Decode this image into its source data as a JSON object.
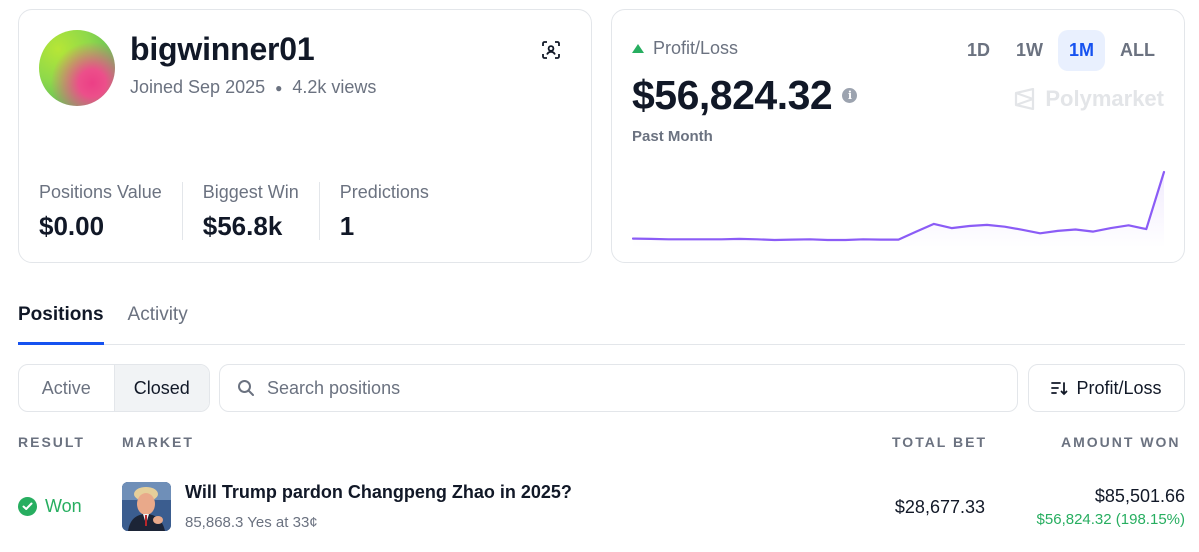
{
  "profile": {
    "username": "bigwinner01",
    "joined": "Joined Sep 2025",
    "views": "4.2k views",
    "stats": [
      {
        "label": "Positions Value",
        "value": "$0.00"
      },
      {
        "label": "Biggest Win",
        "value": "$56.8k"
      },
      {
        "label": "Predictions",
        "value": "1"
      }
    ]
  },
  "pnl": {
    "label": "Profit/Loss",
    "value": "$56,824.32",
    "period": "Past Month",
    "brand": "Polymarket",
    "ranges": [
      "1D",
      "1W",
      "1M",
      "ALL"
    ],
    "active_range": "1M",
    "accent": "#8b5cf6",
    "chart_data": {
      "type": "line",
      "x": [
        0,
        1,
        2,
        3,
        4,
        5,
        6,
        7,
        8,
        9,
        10,
        11,
        12,
        13,
        14,
        15,
        16,
        17,
        18,
        19,
        20,
        21,
        22,
        23,
        24,
        25,
        26,
        27,
        28,
        29,
        30
      ],
      "values": [
        1.0,
        0.9,
        0.8,
        0.8,
        0.8,
        0.8,
        0.9,
        0.8,
        0.6,
        0.7,
        0.8,
        0.6,
        0.6,
        0.8,
        0.7,
        0.7,
        3.0,
        5.2,
        4.0,
        4.6,
        4.9,
        4.4,
        3.5,
        2.5,
        3.2,
        3.6,
        3.0,
        4.0,
        4.8,
        3.7,
        20.0
      ]
    }
  },
  "tabs": [
    "Positions",
    "Activity"
  ],
  "filters": {
    "active": "Active",
    "closed": "Closed",
    "search_placeholder": "Search positions",
    "sort_label": "Profit/Loss"
  },
  "table": {
    "headers": {
      "result": "RESULT",
      "market": "MARKET",
      "total_bet": "TOTAL BET",
      "amount_won": "AMOUNT WON"
    },
    "rows": [
      {
        "result": "Won",
        "title": "Will Trump pardon Changpeng Zhao in 2025?",
        "subtitle": "85,868.3 Yes at 33¢",
        "total_bet": "$28,677.33",
        "amount_won": "$85,501.66",
        "pnl": "$56,824.32 (198.15%)"
      }
    ]
  }
}
